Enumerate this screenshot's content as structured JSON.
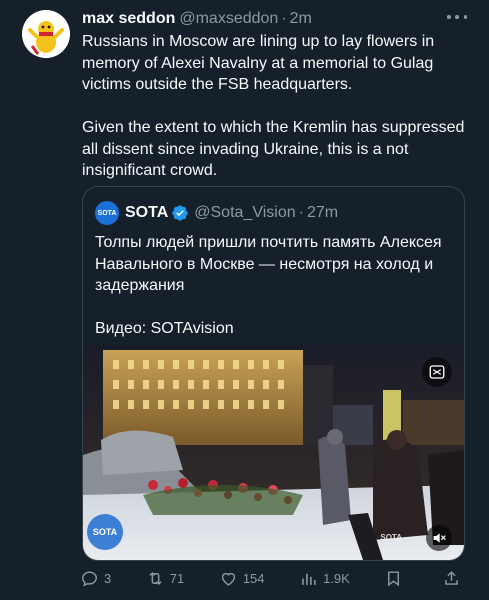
{
  "tweet": {
    "author_name": "max seddon",
    "author_handle": "@maxseddon",
    "separator": "·",
    "time": "2m",
    "paragraphs": [
      "Russians in Moscow are lining up to lay flowers in memory of Alexei Navalny at a memorial to Gulag victims outside the FSB headquarters.",
      "Given the extent to which the Kremlin has suppressed all dissent since invading Ukraine, this is a not insignificant crowd."
    ]
  },
  "quote": {
    "avatar_text": "SOTA",
    "author_name": "SOTA",
    "author_handle": "@Sota_Vision",
    "separator": "·",
    "time": "27m",
    "paragraphs": [
      "Толпы людей пришли почтить память Алексея Навального в Москве — несмотря на холод и задержания",
      "Видео: SOTAvision"
    ],
    "media": {
      "watermark_left": "SOTA",
      "watermark_right": "SOTA"
    }
  },
  "actions": {
    "replies": "3",
    "reposts": "71",
    "likes": "154",
    "views": "1.9K"
  },
  "colors": {
    "background": "#15202b",
    "text": "#f7f9f9",
    "muted": "#8b98a5",
    "border": "#38444d",
    "verified": "#1d9bf0"
  },
  "icons": [
    "more-icon",
    "verified-icon",
    "gif-icon",
    "mute-icon",
    "reply-icon",
    "repost-icon",
    "like-icon",
    "views-icon",
    "bookmark-icon",
    "share-icon"
  ]
}
